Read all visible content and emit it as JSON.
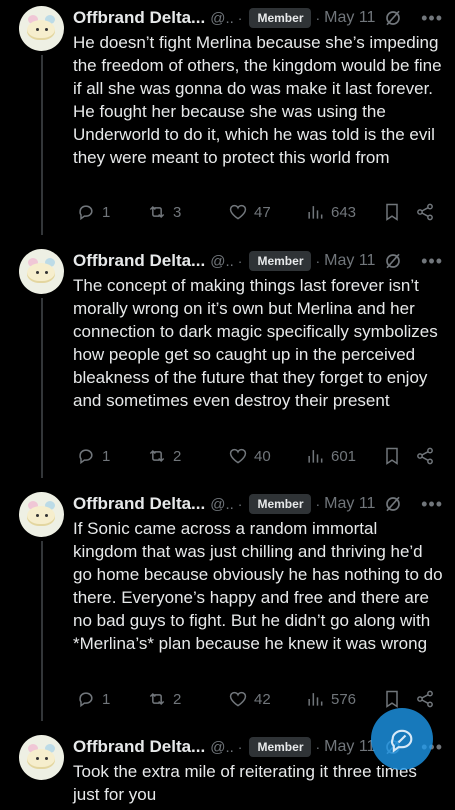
{
  "posts": [
    {
      "author": "Offbrand Delta...",
      "handle": "@..",
      "badge": "Member",
      "date": "May 11",
      "text": "He doesn’t fight Merlina because she’s impeding the freedom of others, the kingdom would be fine if all she was gonna do was make it last forever. He fought her because she was using the Underworld to do it, which he was told is the evil they were meant to protect this world from",
      "replies": "1",
      "reposts": "3",
      "likes": "47",
      "views": "643"
    },
    {
      "author": "Offbrand Delta...",
      "handle": "@..",
      "badge": "Member",
      "date": "May 11",
      "text": "The concept of making things last forever isn’t morally wrong on it’s own but Merlina and her connection to dark magic specifically symbolizes how people get so caught up in the perceived bleakness of the future that they forget to enjoy and sometimes even destroy their present",
      "replies": "1",
      "reposts": "2",
      "likes": "40",
      "views": "601"
    },
    {
      "author": "Offbrand Delta...",
      "handle": "@..",
      "badge": "Member",
      "date": "May 11",
      "text": "If Sonic came across a random immortal kingdom that was just chilling and thriving he’d go home because obviously he has nothing to do there. Everyone’s happy and free and there are no bad guys to fight. But he didn’t go along with *Merlina’s* plan because he knew it was wrong",
      "replies": "1",
      "reposts": "2",
      "likes": "42",
      "views": "576"
    },
    {
      "author": "Offbrand Delta...",
      "handle": "@..",
      "badge": "Member",
      "date": "May 11",
      "text": "Took the extra mile of reiterating it three times just for you"
    }
  ],
  "icons": {
    "reply": "reply-icon",
    "repost": "repost-icon",
    "like": "heart-icon",
    "views": "views-icon",
    "bookmark": "bookmark-icon",
    "share": "share-icon",
    "grok": "grok-icon",
    "more": "more-icon",
    "compose": "compose-icon"
  },
  "colors": {
    "background": "#000000",
    "text": "#e7e9ea",
    "muted": "#71767b",
    "badge_bg": "#2f3336",
    "accent": "#1d9bf0"
  }
}
